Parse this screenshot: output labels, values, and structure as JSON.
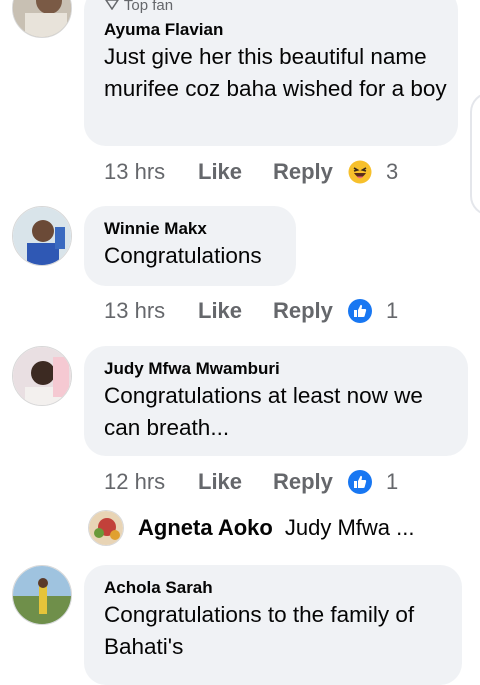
{
  "comments": [
    {
      "badge": "Top fan",
      "author": "Ayuma Flavian",
      "text": "Just give her this beautiful name murifee coz baha wished for a boy",
      "time": "13 hrs",
      "like": "Like",
      "reply": "Reply",
      "reaction_icon": "haha-emoji-icon",
      "reaction_count": "3"
    },
    {
      "author": "Winnie Makx",
      "text": "Congratulations",
      "time": "13 hrs",
      "like": "Like",
      "reply": "Reply",
      "reaction_icon": "like-thumb-icon",
      "reaction_count": "1"
    },
    {
      "author": "Judy Mfwa Mwamburi",
      "text": "Congratulations at least now we can breath...",
      "time": "12 hrs",
      "like": "Like",
      "reply": "Reply",
      "reaction_icon": "like-thumb-icon",
      "reaction_count": "1"
    },
    {
      "author": "Achola Sarah",
      "text": "Congratulations to the family of Bahati's"
    }
  ],
  "reply_preview": {
    "author": "Agneta Aoko",
    "snippet": "Judy Mfwa ..."
  },
  "colors": {
    "bubble": "#f0f2f5",
    "meta_text": "#65676b",
    "like_blue": "#1877f2",
    "haha_yellow": "#f7c02b"
  }
}
